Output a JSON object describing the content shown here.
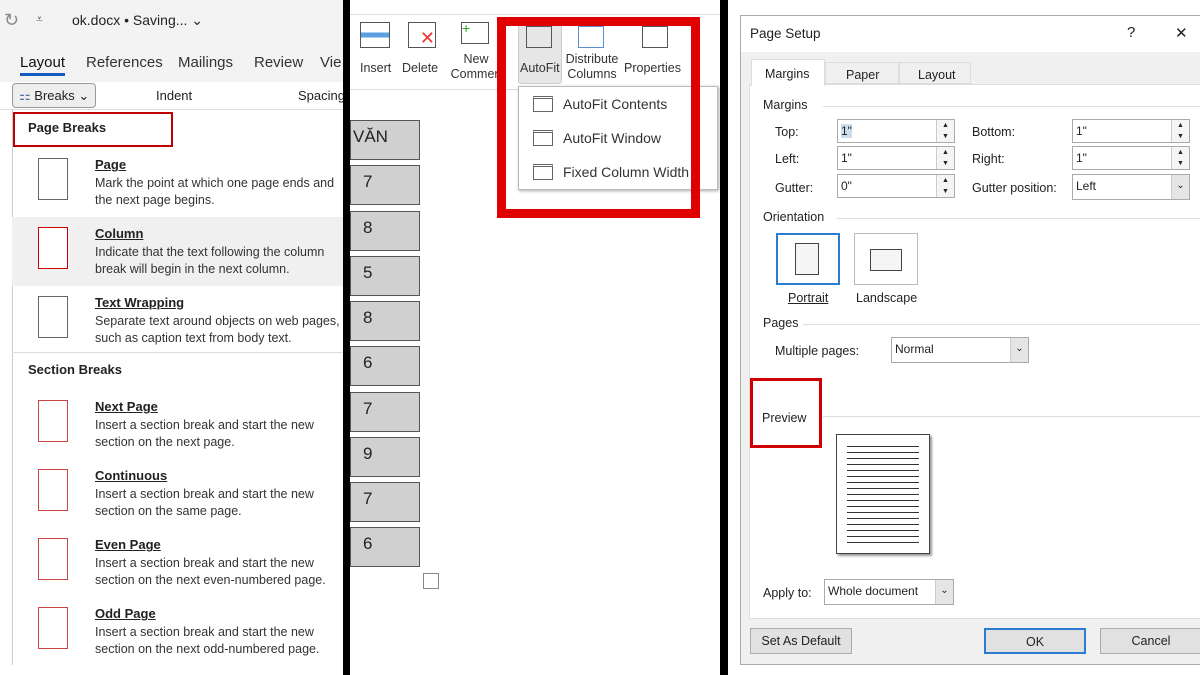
{
  "panel1": {
    "doc_title": "ok.docx • Saving... ⌄",
    "tabs": [
      "Layout",
      "References",
      "Mailings",
      "Review",
      "Vie"
    ],
    "breaks_label": "Breaks ⌄",
    "indent_label": "Indent",
    "spacing_label": "Spacing",
    "page_breaks_header": "Page Breaks",
    "section_breaks_header": "Section Breaks",
    "items": [
      {
        "title": "Page",
        "desc": "Mark the point at which one page ends and the next page begins."
      },
      {
        "title": "Column",
        "desc": "Indicate that the text following the column break will begin in the next column."
      },
      {
        "title": "Text Wrapping",
        "desc": "Separate text around objects on web pages, such as caption text from body text."
      },
      {
        "title": "Next Page",
        "desc": "Insert a section break and start the new section on the next page."
      },
      {
        "title": "Continuous",
        "desc": "Insert a section break and start the new section on the same page."
      },
      {
        "title": "Even Page",
        "desc": "Insert a section break and start the new section on the next even-numbered page."
      },
      {
        "title": "Odd Page",
        "desc": "Insert a section break and start the new section on the next odd-numbered page."
      }
    ]
  },
  "panel2": {
    "ribbon": {
      "insert": "Insert",
      "delete": "Delete",
      "new_comment": "New Commen",
      "autofit": "AutoFit",
      "distribute": "Distribute Columns",
      "properties": "Properties"
    },
    "autofit_menu": [
      "AutoFit Contents",
      "AutoFit Window",
      "Fixed Column Width"
    ],
    "table_cells": [
      "VĂN",
      "7",
      "8",
      "5",
      "8",
      "6",
      "7",
      "9",
      "7",
      "6"
    ],
    "highlight_color": "#e00000"
  },
  "panel3": {
    "title": "Page Setup",
    "help": "?",
    "close": "✕",
    "tabs": [
      "Margins",
      "Paper",
      "Layout"
    ],
    "margins_group": "Margins",
    "top_label": "Top:",
    "top_value": "1\"",
    "bottom_label": "Bottom:",
    "bottom_value": "1\"",
    "left_label": "Left:",
    "left_value": "1\"",
    "right_label": "Right:",
    "right_value": "1\"",
    "gutter_label": "Gutter:",
    "gutter_value": "0\"",
    "gutter_pos_label": "Gutter position:",
    "gutter_pos_value": "Left",
    "orientation_group": "Orientation",
    "portrait": "Portrait",
    "landscape": "Landscape",
    "pages_group": "Pages",
    "multiple_pages_label": "Multiple pages:",
    "multiple_pages_value": "Normal",
    "preview_group": "Preview",
    "apply_to_label": "Apply to:",
    "apply_to_value": "Whole document",
    "set_default": "Set As Default",
    "ok": "OK",
    "cancel": "Cancel"
  }
}
